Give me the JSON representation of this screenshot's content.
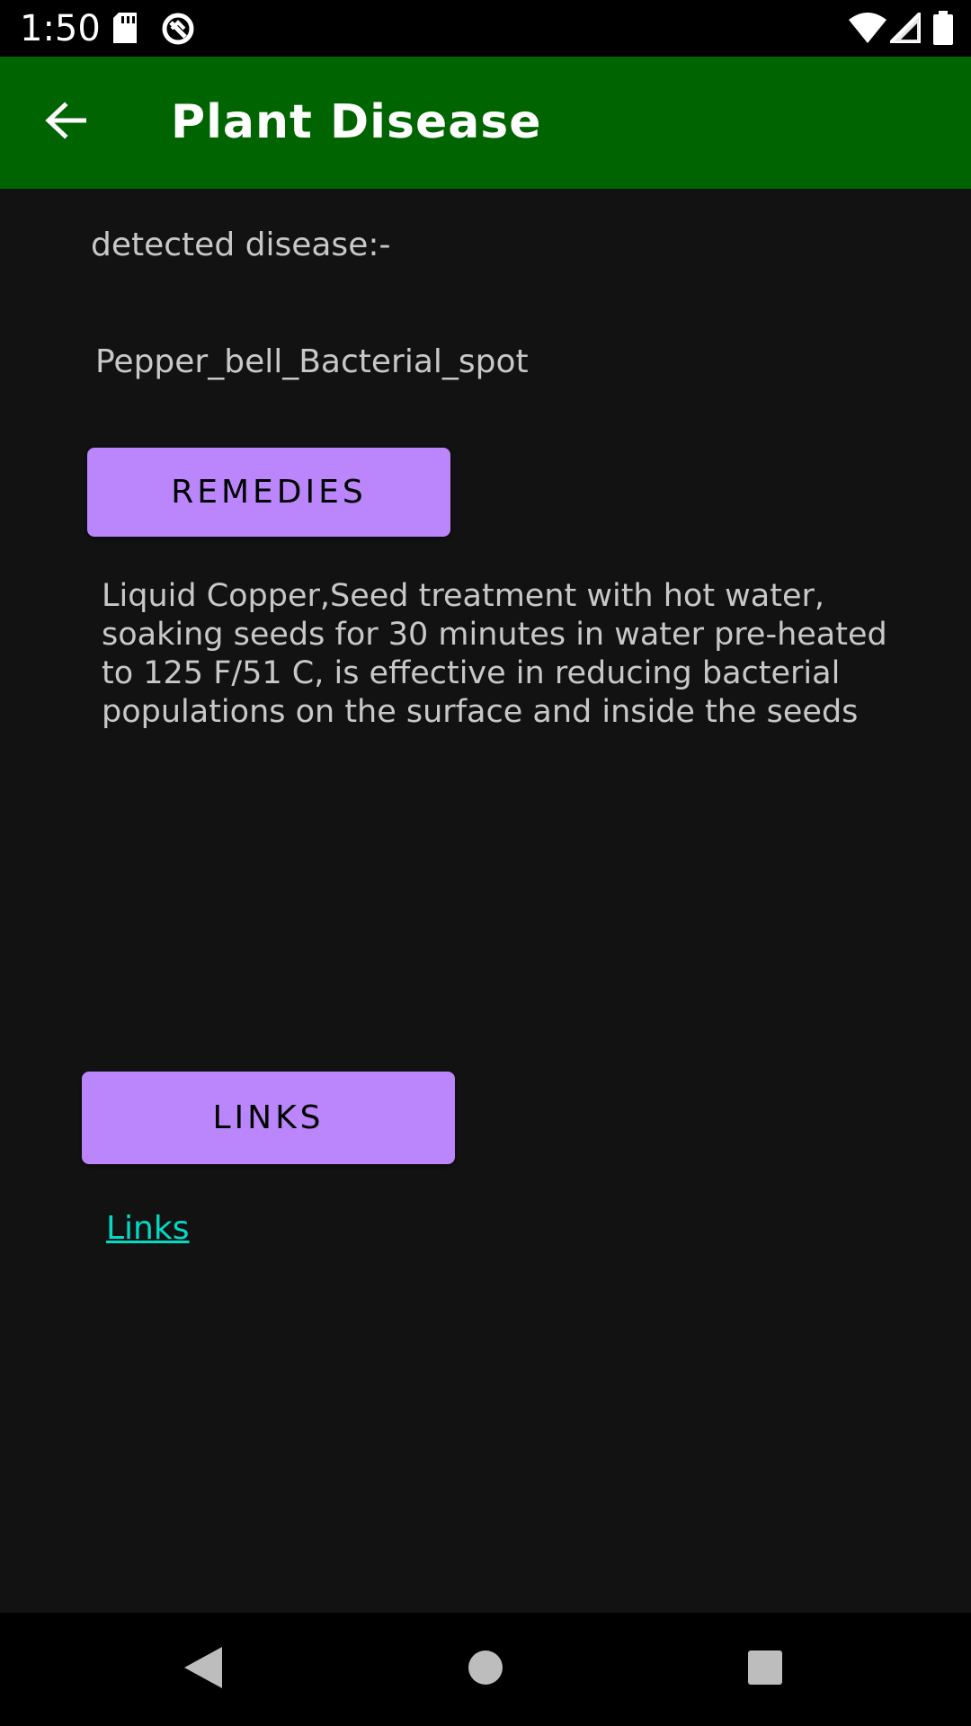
{
  "status_bar": {
    "time": "1:50",
    "icons": [
      "sd-card-icon",
      "sync-icon",
      "wifi-icon",
      "signal-icon",
      "battery-icon"
    ]
  },
  "app_bar": {
    "title": "Plant Disease",
    "back_icon": "arrow-back-icon",
    "background_color": "#006400"
  },
  "main": {
    "detected_label": "detected disease:-",
    "disease_name": "Pepper_bell_Bacterial_spot",
    "remedies_button": "REMEDIES",
    "remedy_text": "Liquid Copper,Seed treatment with hot water, soaking seeds for 30 minutes in water pre-heated to 125 F/51 C, is effective in reducing bacterial populations on the surface and inside the seeds",
    "links_button": "LINKS",
    "link_text": "Links"
  },
  "nav_bar": {
    "icons": [
      "back-triangle-icon",
      "home-circle-icon",
      "recents-square-icon"
    ]
  },
  "colors": {
    "background": "#121212",
    "button": "#bb86fc",
    "link": "#03dac5",
    "text": "#c8c8c8"
  }
}
